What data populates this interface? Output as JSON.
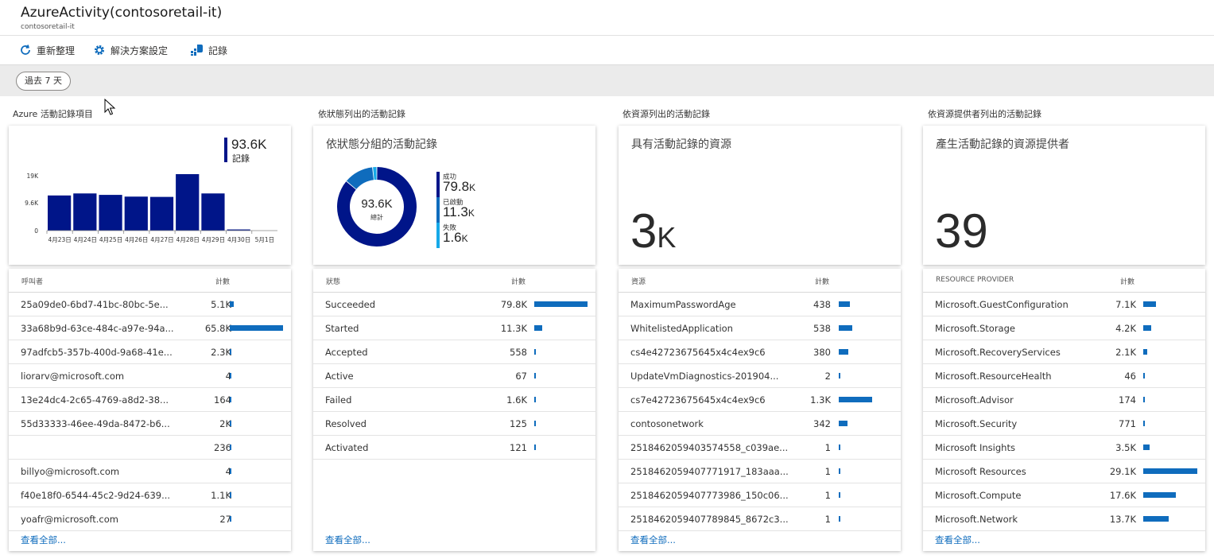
{
  "header": {
    "title": "AzureActivity(contosoretail-it)",
    "subtitle": "contosoretail-it"
  },
  "toolbar": {
    "refresh": "重新整理",
    "settings": "解決方案設定",
    "logs": "記錄"
  },
  "filter": {
    "time_range": "過去 7 天"
  },
  "colors": {
    "navy": "#001589",
    "blue": "#0f6cbd",
    "cyan": "#16a9e8",
    "link": "#0f6cbd"
  },
  "sections": [
    {
      "title": "Azure 活動記錄項目",
      "summary_value": "93.6K",
      "summary_label": "記錄",
      "table": {
        "col1": "呼叫者",
        "col2": "計數",
        "rows": [
          {
            "name": "25a09de0-6bd7-41bc-80bc-5e...",
            "count": "5.1K",
            "frac": 0.078
          },
          {
            "name": "33a68b9d-63ce-484c-a97e-94a...",
            "count": "65.8K",
            "frac": 1.0
          },
          {
            "name": "97adfcb5-357b-400d-9a68-41e...",
            "count": "2.3K",
            "frac": 0.035
          },
          {
            "name": "liorarv@microsoft.com",
            "count": "4",
            "frac": 0.0
          },
          {
            "name": "13e24dc4-2c65-4769-a8d2-38...",
            "count": "164",
            "frac": 0.003
          },
          {
            "name": "55d33333-46ee-49da-8472-b6...",
            "count": "2K",
            "frac": 0.03
          },
          {
            "name": "",
            "count": "236",
            "frac": 0.004
          },
          {
            "name": "billyo@microsoft.com",
            "count": "4",
            "frac": 0.0
          },
          {
            "name": "f40e18f0-6544-45c2-9d24-639...",
            "count": "1.1K",
            "frac": 0.017
          },
          {
            "name": "yoafr@microsoft.com",
            "count": "27",
            "frac": 0.0
          }
        ],
        "see_all": "查看全部..."
      }
    },
    {
      "title": "依狀態列出的活動記錄",
      "card_heading": "依狀態分組的活動記錄",
      "donut_center_value": "93.6K",
      "donut_center_label": "總計",
      "legend": [
        {
          "label": "成功",
          "value": "79.8",
          "unit": "K",
          "amount": 79.8,
          "color": "#001589"
        },
        {
          "label": "已啟動",
          "value": "11.3",
          "unit": "K",
          "amount": 11.3,
          "color": "#0f6cbd"
        },
        {
          "label": "失敗",
          "value": "1.6",
          "unit": "K",
          "amount": 1.6,
          "color": "#16a9e8"
        }
      ],
      "table": {
        "col1": "狀態",
        "col2": "計數",
        "rows": [
          {
            "name": "Succeeded",
            "count": "79.8K",
            "frac": 1.0
          },
          {
            "name": "Started",
            "count": "11.3K",
            "frac": 0.142
          },
          {
            "name": "Accepted",
            "count": "558",
            "frac": 0.007
          },
          {
            "name": "Active",
            "count": "67",
            "frac": 0.001
          },
          {
            "name": "Failed",
            "count": "1.6K",
            "frac": 0.02
          },
          {
            "name": "Resolved",
            "count": "125",
            "frac": 0.002
          },
          {
            "name": "Activated",
            "count": "121",
            "frac": 0.002
          }
        ],
        "see_all": "查看全部..."
      }
    },
    {
      "title": "依資源列出的活動記錄",
      "card_heading": "具有活動記錄的資源",
      "big_value": "3",
      "big_suffix": "K",
      "table": {
        "col1": "資源",
        "col2": "計數",
        "rows": [
          {
            "name": "MaximumPasswordAge",
            "count": "438",
            "frac": 0.34
          },
          {
            "name": "WhitelistedApplication",
            "count": "538",
            "frac": 0.41
          },
          {
            "name": "cs4e42723675645x4c4ex9c6",
            "count": "380",
            "frac": 0.29
          },
          {
            "name": "UpdateVmDiagnostics-201904...",
            "count": "2",
            "frac": 0.01
          },
          {
            "name": "cs7e42723675645x4c4ex9c6",
            "count": "1.3K",
            "frac": 1.0
          },
          {
            "name": "contosonetwork",
            "count": "342",
            "frac": 0.26
          },
          {
            "name": "2518462059403574558_c039ae...",
            "count": "1",
            "frac": 0.01
          },
          {
            "name": "2518462059407771917_183aaa...",
            "count": "1",
            "frac": 0.01
          },
          {
            "name": "2518462059407773986_150c06...",
            "count": "1",
            "frac": 0.01
          },
          {
            "name": "2518462059407789845_8672c3...",
            "count": "1",
            "frac": 0.01
          }
        ],
        "see_all": "查看全部..."
      }
    },
    {
      "title": "依資源提供者列出的活動記錄",
      "card_heading": "產生活動記錄的資源提供者",
      "big_value": "39",
      "big_suffix": "",
      "table": {
        "col1": "RESOURCE PROVIDER",
        "col2": "計數",
        "rows": [
          {
            "name": "Microsoft.GuestConfiguration",
            "count": "7.1K",
            "frac": 0.24
          },
          {
            "name": "Microsoft.Storage",
            "count": "4.2K",
            "frac": 0.145
          },
          {
            "name": "Microsoft.RecoveryServices",
            "count": "2.1K",
            "frac": 0.072
          },
          {
            "name": "Microsoft.ResourceHealth",
            "count": "46",
            "frac": 0.002
          },
          {
            "name": "Microsoft.Advisor",
            "count": "174",
            "frac": 0.006
          },
          {
            "name": "Microsoft.Security",
            "count": "771",
            "frac": 0.026
          },
          {
            "name": "Microsoft Insights",
            "count": "3.5K",
            "frac": 0.12
          },
          {
            "name": "Microsoft Resources",
            "count": "29.1K",
            "frac": 1.0
          },
          {
            "name": "Microsoft.Compute",
            "count": "17.6K",
            "frac": 0.6
          },
          {
            "name": "Microsoft.Network",
            "count": "13.7K",
            "frac": 0.47
          }
        ],
        "see_all": "查看全部..."
      }
    }
  ],
  "chart_data": [
    {
      "type": "bar",
      "categories": [
        "4月23日",
        "4月24日",
        "4月25日",
        "4月26日",
        "4月27日",
        "4月28日",
        "4月29日",
        "4月30日",
        "5月1日"
      ],
      "values": [
        12.2,
        12.9,
        12.4,
        11.8,
        11.7,
        19.6,
        12.9,
        0.4,
        0
      ],
      "ylim": [
        0,
        19.6
      ],
      "yticks": [
        "0",
        "9.6K",
        "19K"
      ],
      "color": "#001589"
    },
    {
      "type": "pie",
      "categories": [
        "成功",
        "已啟動",
        "失敗"
      ],
      "values": [
        79.8,
        11.3,
        1.6
      ]
    }
  ]
}
